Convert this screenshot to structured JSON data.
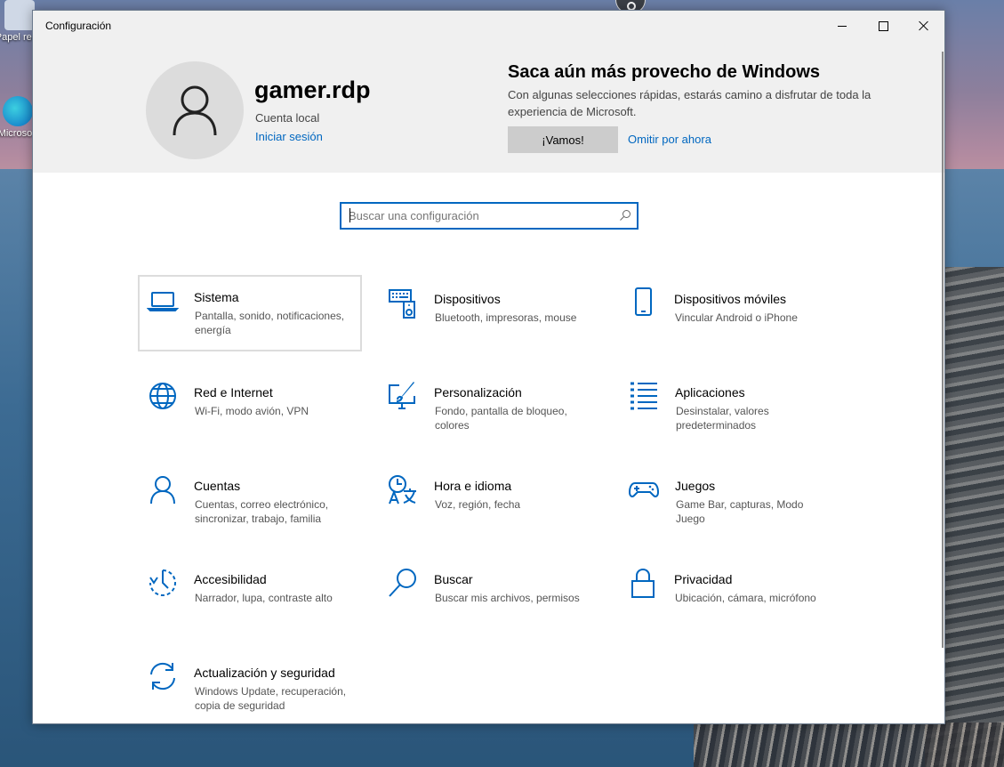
{
  "desktop": {
    "icons": [
      {
        "label": "Papel recic"
      },
      {
        "label": "Microsoft"
      }
    ]
  },
  "window": {
    "title": "Configuración"
  },
  "header": {
    "username": "gamer.rdp",
    "account_type": "Cuenta local",
    "signin_link": "Iniciar sesión",
    "promo_title": "Saca aún más provecho de Windows",
    "promo_text": "Con algunas selecciones rápidas, estarás camino a disfrutar de toda la experiencia de Microsoft.",
    "primary_button": "¡Vamos!",
    "skip_link": "Omitir por ahora"
  },
  "search": {
    "placeholder": "Buscar una configuración"
  },
  "categories": [
    {
      "name": "Sistema",
      "desc": "Pantalla, sonido, notificaciones, energía",
      "icon": "laptop-icon",
      "selected": true
    },
    {
      "name": "Dispositivos",
      "desc": "Bluetooth, impresoras, mouse",
      "icon": "devices-icon"
    },
    {
      "name": "Dispositivos móviles",
      "desc": "Vincular Android o iPhone",
      "icon": "phone-icon"
    },
    {
      "name": "Red e Internet",
      "desc": "Wi-Fi, modo avión, VPN",
      "icon": "globe-icon"
    },
    {
      "name": "Personalización",
      "desc": "Fondo, pantalla de bloqueo, colores",
      "icon": "paint-icon"
    },
    {
      "name": "Aplicaciones",
      "desc": "Desinstalar, valores predeterminados",
      "icon": "apps-list-icon"
    },
    {
      "name": "Cuentas",
      "desc": "Cuentas, correo electrónico, sincronizar, trabajo, familia",
      "icon": "person-icon"
    },
    {
      "name": "Hora e idioma",
      "desc": "Voz, región, fecha",
      "icon": "time-language-icon"
    },
    {
      "name": "Juegos",
      "desc": "Game Bar, capturas, Modo Juego",
      "icon": "gamepad-icon"
    },
    {
      "name": "Accesibilidad",
      "desc": "Narrador, lupa, contraste alto",
      "icon": "accessibility-icon"
    },
    {
      "name": "Buscar",
      "desc": "Buscar mis archivos, permisos",
      "icon": "magnifier-icon"
    },
    {
      "name": "Privacidad",
      "desc": "Ubicación, cámara, micrófono",
      "icon": "lock-icon"
    },
    {
      "name": "Actualización y seguridad",
      "desc": "Windows Update, recuperación, copia de seguridad",
      "icon": "update-icon"
    }
  ],
  "colors": {
    "accent": "#0067c0",
    "header_bg": "#f0f0f0"
  }
}
